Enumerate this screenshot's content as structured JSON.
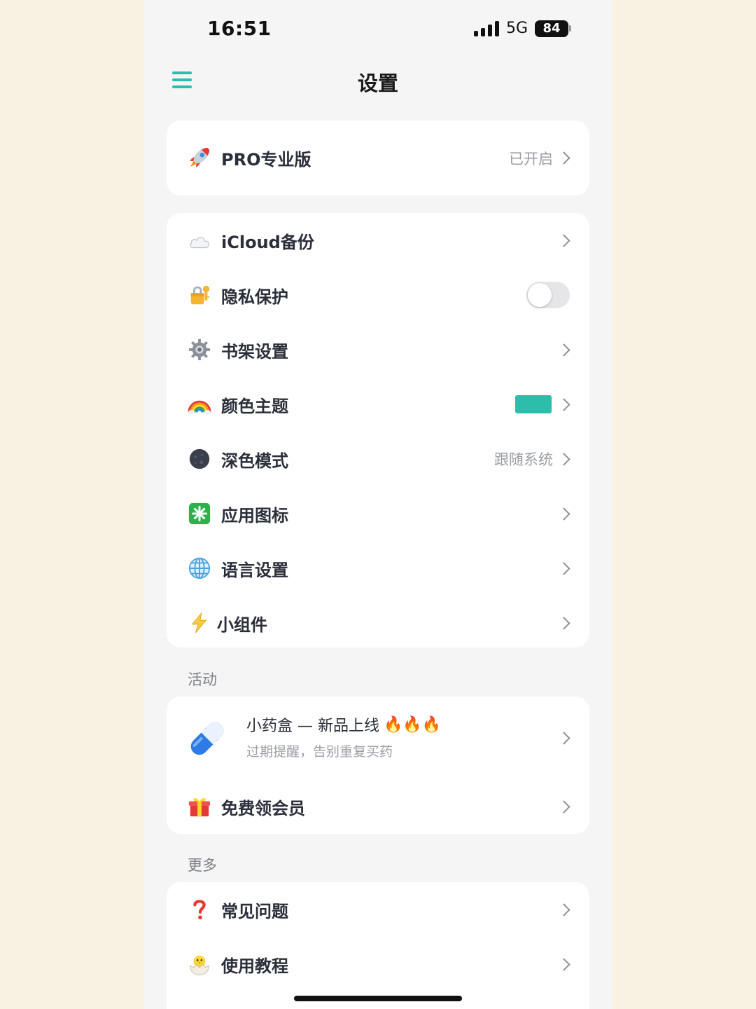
{
  "status_bar": {
    "time": "16:51",
    "network": "5G",
    "battery": "84"
  },
  "nav": {
    "title": "设置",
    "menu_icon": "hamburger-icon"
  },
  "pro": {
    "icon": "rocket-icon",
    "label": "PRO专业版",
    "value": "已开启"
  },
  "settings": {
    "items": [
      {
        "icon": "cloud-icon",
        "label": "iCloud备份"
      },
      {
        "icon": "lock-key-icon",
        "label": "隐私保护",
        "toggle": false
      },
      {
        "icon": "gear-icon",
        "label": "书架设置"
      },
      {
        "icon": "rainbow-icon",
        "label": "颜色主题",
        "swatch": "#2dbdab"
      },
      {
        "icon": "dark-moon-icon",
        "label": "深色模式",
        "value": "跟随系统"
      },
      {
        "icon": "app-icon-icon",
        "label": "应用图标"
      },
      {
        "icon": "globe-icon",
        "label": "语言设置"
      },
      {
        "icon": "lightning-icon",
        "label": "小组件"
      }
    ]
  },
  "activity": {
    "section_title": "活动",
    "promo": {
      "icon": "pill-icon",
      "title": "小药盒 — 新品上线",
      "fire": "🔥🔥🔥",
      "subtitle": "过期提醒，告别重复买药"
    },
    "free_member": {
      "icon": "gift-icon",
      "label": "免费领会员"
    }
  },
  "more": {
    "section_title": "更多",
    "items": [
      {
        "icon": "question-icon",
        "label": "常见问题"
      },
      {
        "icon": "hatching-chick-icon",
        "label": "使用教程"
      }
    ]
  },
  "colors": {
    "accent": "#2dbdab",
    "page_bg": "#f5f5f5",
    "outer_bg": "#f7f2e2"
  }
}
